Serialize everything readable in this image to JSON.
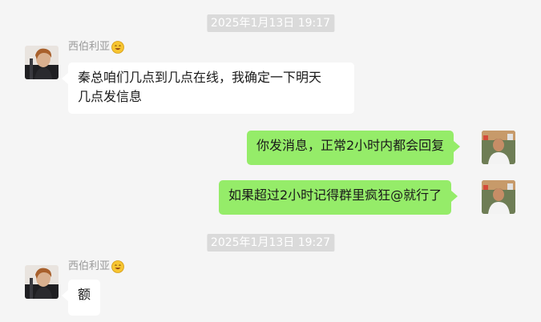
{
  "colors": {
    "background": "#f5f5f5",
    "incoming_bubble": "#ffffff",
    "outgoing_bubble": "#95ec69",
    "timestamp_bg": "#dadada",
    "timestamp_text": "#ffffff",
    "sender_name": "#9a9a9a"
  },
  "messages": {
    "ts1": "2025年1月13日 19:17",
    "group1": {
      "sender_name": "西伯利亚",
      "sender_emoji": "smiley-face-emoji",
      "avatar_icon": "user-avatar-portrait",
      "text_line1": "秦总咱们几点到几点在线，我确定一下明天",
      "text_line2": "几点发信息"
    },
    "out1": {
      "text": "你发消息，正常2小时内都会回复",
      "avatar_icon": "self-avatar-photo"
    },
    "out2": {
      "text": "如果超过2小时记得群里疯狂@就行了",
      "avatar_icon": "self-avatar-photo"
    },
    "ts2": "2025年1月13日 19:27",
    "group2": {
      "sender_name": "西伯利亚",
      "sender_emoji": "smiley-face-emoji",
      "avatar_icon": "user-avatar-portrait",
      "text": "额"
    }
  }
}
